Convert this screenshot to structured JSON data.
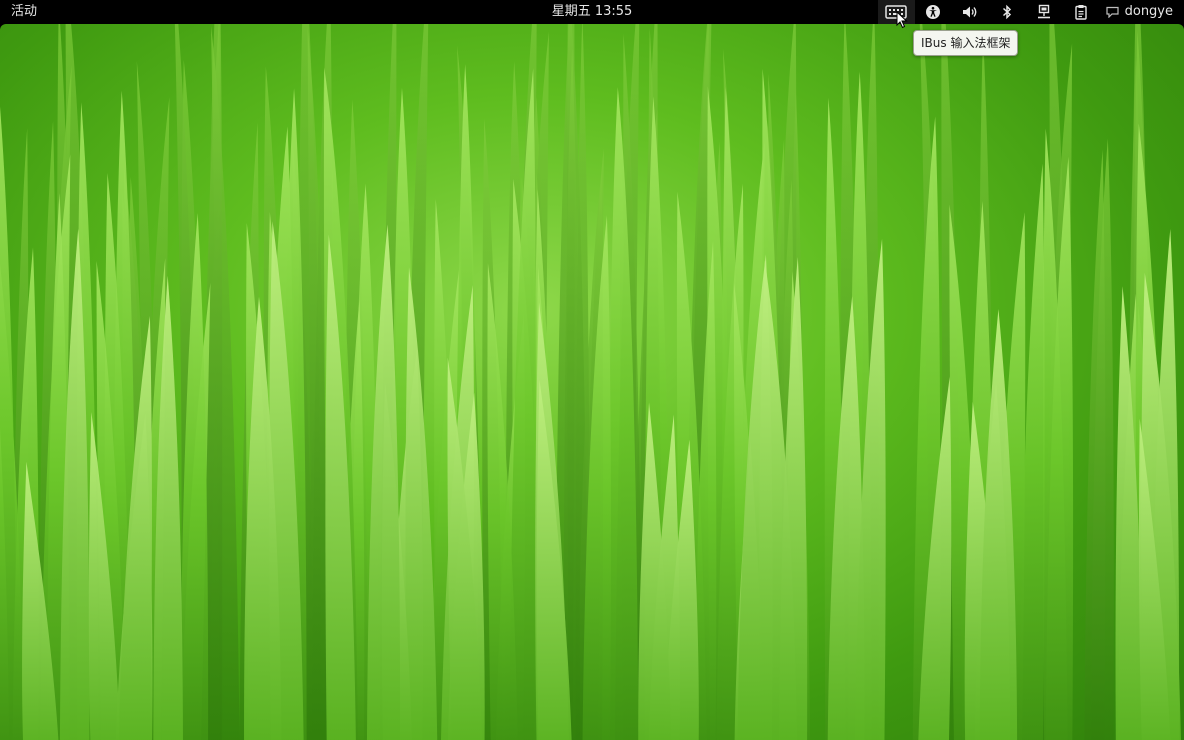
{
  "topbar": {
    "activities_label": "活动",
    "clock_text": "星期五 13:55",
    "tray": [
      {
        "name": "keyboard-icon",
        "label": "keyboard input method"
      },
      {
        "name": "accessibility-icon",
        "label": "accessibility"
      },
      {
        "name": "volume-icon",
        "label": "volume"
      },
      {
        "name": "bluetooth-icon",
        "label": "bluetooth"
      },
      {
        "name": "network-icon",
        "label": "network"
      },
      {
        "name": "clipboard-icon",
        "label": "clipboard"
      }
    ],
    "user_name": "dongye"
  },
  "tooltip": {
    "text": "IBus 输入法框架"
  },
  "colors": {
    "topbar_bg": "#000000",
    "topbar_text": "#e6e6e6",
    "wallpaper_light": "#8ed84a",
    "wallpaper_dark": "#2f7f0b"
  }
}
